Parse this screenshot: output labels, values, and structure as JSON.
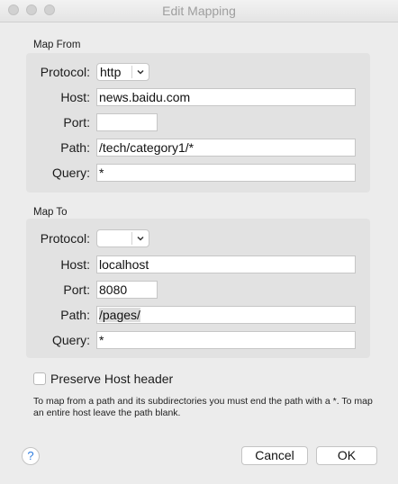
{
  "window": {
    "title": "Edit Mapping"
  },
  "map_from": {
    "heading": "Map From",
    "protocol_label": "Protocol:",
    "protocol_value": "http",
    "host_label": "Host:",
    "host_value": "news.baidu.com",
    "port_label": "Port:",
    "port_value": "",
    "path_label": "Path:",
    "path_value": "/tech/category1/*",
    "query_label": "Query:",
    "query_value": "*"
  },
  "map_to": {
    "heading": "Map To",
    "protocol_label": "Protocol:",
    "protocol_value": "",
    "host_label": "Host:",
    "host_value": "localhost",
    "port_label": "Port:",
    "port_value": "8080",
    "path_label": "Path:",
    "path_value": "/pages/",
    "query_label": "Query:",
    "query_value": "*"
  },
  "options": {
    "preserve_host_label": "Preserve Host header",
    "preserve_host_checked": false
  },
  "help_text": "To map from a path and its subdirectories you must end the path with a *. To map an entire host leave the path blank.",
  "footer": {
    "help_glyph": "?",
    "cancel_label": "Cancel",
    "ok_label": "OK"
  },
  "colors": {
    "background": "#ececec",
    "group_background": "#e2e2e2",
    "help_accent": "#2f7ddf"
  }
}
